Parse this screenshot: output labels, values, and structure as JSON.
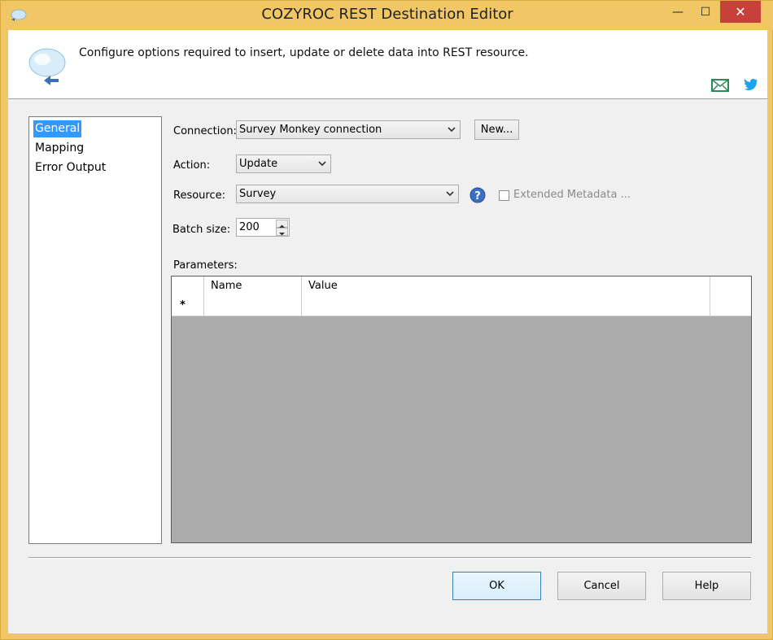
{
  "window": {
    "title": "COZYROC REST Destination Editor",
    "controls": {
      "minimize": "—",
      "maximize": "☐",
      "close": "✕"
    }
  },
  "header": {
    "description": "Configure options required to insert, update or delete data into REST resource.",
    "icons": [
      "cloud-icon",
      "email-icon",
      "twitter-icon"
    ]
  },
  "nav": {
    "items": [
      {
        "label": "General",
        "selected": true
      },
      {
        "label": "Mapping",
        "selected": false
      },
      {
        "label": "Error Output",
        "selected": false
      }
    ]
  },
  "form": {
    "connection_label": "Connection:",
    "connection_value": "Survey Monkey connection",
    "new_button": "New...",
    "action_label": "Action:",
    "action_value": "Update",
    "resource_label": "Resource:",
    "resource_value": "Survey",
    "extended_metadata_label": "Extended Metadata ...",
    "extended_metadata_checked": false,
    "batch_size_label": "Batch size:",
    "batch_size_value": "200",
    "parameters_label": "Parameters:"
  },
  "parameters_grid": {
    "columns": [
      "",
      "Name",
      "Value"
    ],
    "rows": [
      {
        "marker": "*",
        "name": "",
        "value": ""
      }
    ]
  },
  "buttons": {
    "ok": "OK",
    "cancel": "Cancel",
    "help": "Help"
  },
  "colors": {
    "titlebar": "#f0c764",
    "close_button": "#c7413a",
    "selection": "#3399ff",
    "grid_empty": "#ababab"
  }
}
